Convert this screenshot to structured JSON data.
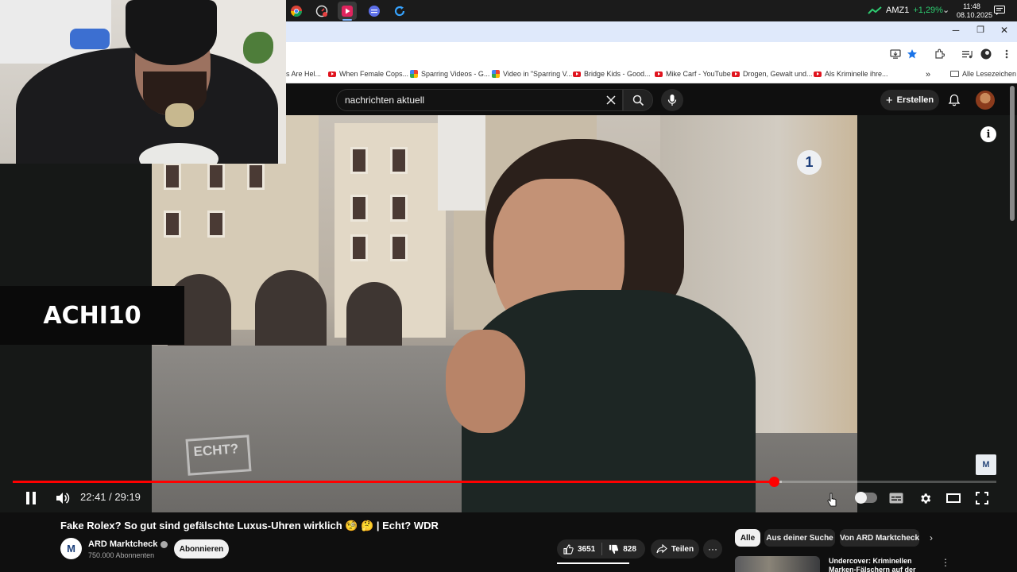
{
  "taskbar": {
    "apps": [
      {
        "name": "chrome-app",
        "color": "#4285f4"
      },
      {
        "name": "speedometer-app",
        "color": "#e64040"
      },
      {
        "name": "media-player-app",
        "color": "#e0245e"
      },
      {
        "name": "chat-app",
        "color": "#5b6ee8"
      },
      {
        "name": "refresh-app",
        "color": "#36a3ff"
      }
    ],
    "stock_name": "AMZ1",
    "stock_change": "+1,29%",
    "time": "11:48",
    "date": "08.10.2025"
  },
  "bookmarks": {
    "items": [
      {
        "label": "s Are Hel...",
        "icon": "none"
      },
      {
        "label": "When Female Cops...",
        "icon": "youtube"
      },
      {
        "label": "Sparring Videos - G...",
        "icon": "pinwheel"
      },
      {
        "label": "Video in \"Sparring V...",
        "icon": "pinwheel"
      },
      {
        "label": "Bridge Kids - Good...",
        "icon": "youtube"
      },
      {
        "label": "Mike Carf - YouTube",
        "icon": "youtube"
      },
      {
        "label": "Drogen, Gewalt und...",
        "icon": "youtube"
      },
      {
        "label": "Als Kriminelle ihre...",
        "icon": "youtube"
      }
    ],
    "overflow": "»",
    "all_label": "Alle Lesezeichen"
  },
  "header": {
    "search_value": "nachrichten aktuell",
    "create_label": "Erstellen"
  },
  "video": {
    "overlay_brand": "ACHI10",
    "broadcaster_logo": "1",
    "echt_logo": "ECHT?",
    "watermark": "M",
    "info": "i"
  },
  "player": {
    "current_time": "22:41",
    "duration": "29:19",
    "time_display": "22:41 / 29:19",
    "progress_fraction": 0.774,
    "buffer_fraction": 0.782
  },
  "below": {
    "title": "Fake Rolex? So gut sind gefälschte Luxus-Uhren wirklich 🧐 🤔 | Echt? WDR",
    "channel_avatar": "M",
    "channel_name": "ARD Marktcheck",
    "subscribers": "750.000 Abonnenten",
    "subscribe_label": "Abonnieren",
    "likes": "3651",
    "dislikes": "828",
    "share_label": "Teilen",
    "more_label": "···"
  },
  "sidebar": {
    "chips": [
      "Alle",
      "Aus deiner Suche",
      "Von ARD Marktcheck"
    ],
    "chip_next": "›",
    "rec_title": "Undercover: Kriminellen Marken-Fälschern auf der Spu...",
    "rec_more": "⋮"
  },
  "colors": {
    "accent_red": "#ff0000",
    "stock_green": "#2ecc71"
  }
}
